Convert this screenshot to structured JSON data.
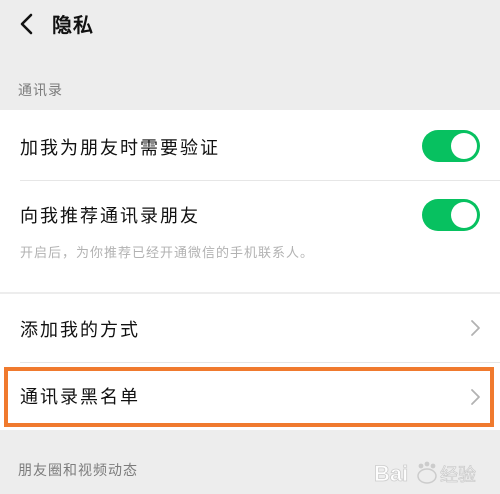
{
  "header": {
    "title": "隐私",
    "back_icon": "chevron-left-icon"
  },
  "sections": [
    {
      "label": "通讯录"
    },
    {
      "label": "朋友圈和视频动态"
    }
  ],
  "rows": {
    "verify": {
      "label": "加我为朋友时需要验证",
      "toggle_on": true
    },
    "recommend": {
      "label": "向我推荐通讯录朋友",
      "toggle_on": true,
      "description": "开启后，为你推荐已经开通微信的手机联系人。"
    },
    "add_methods": {
      "label": "添加我的方式",
      "icon": "chevron-right-icon"
    },
    "blacklist": {
      "label": "通讯录黑名单",
      "icon": "chevron-right-icon"
    }
  },
  "colors": {
    "accent": "#07c160",
    "highlight": "#f07a2e",
    "background": "#ededed"
  },
  "watermark": {
    "text": "Bai经验"
  }
}
